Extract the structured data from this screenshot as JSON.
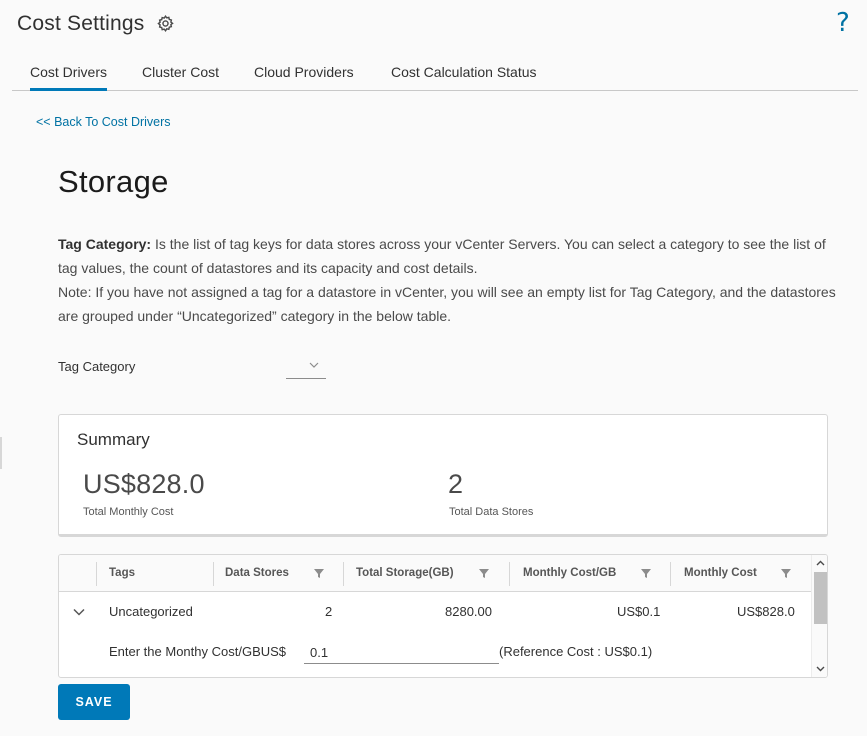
{
  "header": {
    "title": "Cost Settings",
    "settings_icon": "gear-icon",
    "help_icon": "?"
  },
  "tabs": [
    {
      "label": "Cost Drivers",
      "active": true
    },
    {
      "label": "Cluster Cost",
      "active": false
    },
    {
      "label": "Cloud Providers",
      "active": false
    },
    {
      "label": "Cost Calculation Status",
      "active": false
    }
  ],
  "back_link": "<< Back To Cost Drivers",
  "page": {
    "heading": "Storage",
    "description_bold": "Tag Category:",
    "description_line1": " Is the list of tag keys for data stores across your vCenter Servers. You can select a category to see the list of tag values, the count of datastores and its capacity and cost details.",
    "description_line2": "Note: If you have not assigned a tag for a datastore in vCenter, you will see an empty list for Tag Category, and the datastores are grouped under “Uncategorized” category in the below table."
  },
  "tag_category": {
    "label": "Tag Category",
    "selected": ""
  },
  "summary": {
    "title": "Summary",
    "total_monthly_cost_value": "US$828.0",
    "total_monthly_cost_label": "Total Monthly Cost",
    "total_data_stores_value": "2",
    "total_data_stores_label": "Total Data Stores"
  },
  "table": {
    "columns": [
      "Tags",
      "Data Stores",
      "Total Storage(GB)",
      "Monthly Cost/GB",
      "Monthly Cost"
    ],
    "rows": [
      {
        "tags": "Uncategorized",
        "data_stores": "2",
        "total_storage": "8280.00",
        "monthly_cost_per_gb": "US$0.1",
        "monthly_cost": "US$828.0",
        "detail": {
          "input_label": "Enter the Monthy Cost/GBUS$",
          "input_value": "0.1",
          "reference": "(Reference Cost : US$0.1)"
        }
      }
    ]
  },
  "actions": {
    "save_label": "SAVE"
  },
  "colors": {
    "accent": "#0079b8",
    "link": "#0072a3"
  }
}
